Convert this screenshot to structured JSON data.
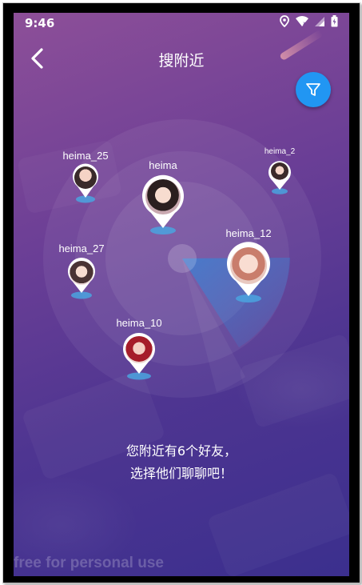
{
  "status_bar": {
    "time": "9:46",
    "icons": [
      "location-icon",
      "wifi-icon",
      "signal-icon",
      "battery-icon"
    ]
  },
  "header": {
    "back_icon": "chevron-left-icon",
    "title": "搜附近",
    "filter_icon": "filter-icon"
  },
  "colors": {
    "accent": "#2196f3",
    "pin_border": "#ffffff",
    "pin_shadow": "#4aa3df",
    "bg_top": "#8d4f98",
    "bg_bottom": "#3b2f8e"
  },
  "nearby_users": [
    {
      "name": "heima_25"
    },
    {
      "name": "heima"
    },
    {
      "name": "heima_2"
    },
    {
      "name": "heima_27"
    },
    {
      "name": "heima_12"
    },
    {
      "name": "heima_10"
    }
  ],
  "message": {
    "line1": "您附近有6个好友，",
    "line2": "选择他们聊聊吧！"
  },
  "watermark": "free for personal use"
}
